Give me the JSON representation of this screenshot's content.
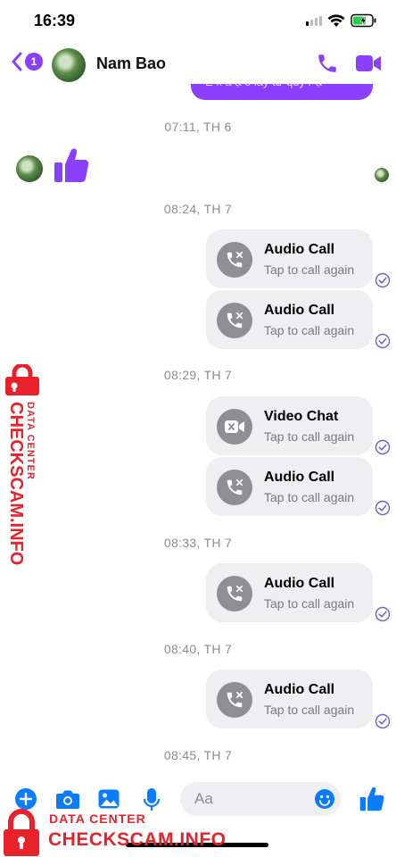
{
  "status_bar": {
    "time": "16:39"
  },
  "header": {
    "unread_count": "1",
    "contact_name": "Nam Bao"
  },
  "prev_message_fragment": "E k a ạ e lấy từ quỹ r ạ",
  "timestamps": [
    "07:11, TH 6",
    "08:24, TH 7",
    "08:29, TH 7",
    "08:33, TH 7",
    "08:40, TH 7",
    "08:45, TH 7"
  ],
  "calls": [
    {
      "title": "Audio Call",
      "subtitle": "Tap to call again"
    },
    {
      "title": "Audio Call",
      "subtitle": "Tap to call again"
    },
    {
      "title": "Video Chat",
      "subtitle": "Tap to call again"
    },
    {
      "title": "Audio Call",
      "subtitle": "Tap to call again"
    },
    {
      "title": "Audio Call",
      "subtitle": "Tap to call again"
    },
    {
      "title": "Audio Call",
      "subtitle": "Tap to call again"
    }
  ],
  "composer": {
    "placeholder": "Aa"
  },
  "watermark": {
    "line1": "DATA CENTER",
    "line2": "CHECKSCAM.INFO"
  },
  "colors": {
    "accent": "#8a3ffc",
    "link_blue": "#0a7cff",
    "watermark_red": "#e8212b"
  },
  "icons": [
    "back-chevron-icon",
    "phone-icon",
    "video-camera-icon",
    "like-thumb-icon",
    "missed-call-icon",
    "missed-video-icon",
    "seen-check-icon",
    "plus-icon",
    "camera-icon",
    "gallery-icon",
    "microphone-icon",
    "emoji-icon",
    "lock-icon"
  ]
}
